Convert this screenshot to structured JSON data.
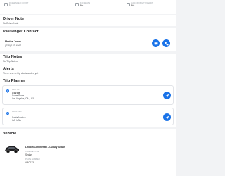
{
  "top_stats": [
    {
      "label": "PASSENGER COUNT",
      "value": "1"
    },
    {
      "label": "KID SEATS",
      "value": "No"
    },
    {
      "label": "ACCESSIBILITY NEEDS",
      "value": "No"
    }
  ],
  "driver_note": {
    "title": "Driver Note",
    "text": "No Driver Note"
  },
  "passenger_contact": {
    "title": "Passenger Contact",
    "name": "Martha Jones",
    "phone": "(718) 123-4567"
  },
  "trip_notes": {
    "title": "Trip Notes",
    "text": "No Trip Notes"
  },
  "alerts": {
    "title": "Alerts",
    "text": "There are no trip alerts added yet"
  },
  "trip_planner": {
    "title": "Trip Planner",
    "stops": [
      {
        "label": "PICK UP",
        "time": "4:00 pm",
        "line1": "Some Place",
        "line2": "Los Angeles, CA, USA"
      },
      {
        "label": "DROP OFF",
        "time": "—",
        "line1": "Santa Monica",
        "line2": "CA, USA"
      }
    ]
  },
  "vehicle": {
    "title": "Vehicle",
    "name": "Lincoln Continental – Luxury Sedan",
    "type_label": "VEHICLE TYPE",
    "type_value": "Sedan",
    "plate_label": "PLATE NUMBER",
    "plate_value": "ABC123"
  },
  "colors": {
    "accent": "#1a73e8",
    "background": "#f2f3f5",
    "card": "#ffffff"
  },
  "icons": [
    "person-icon",
    "child-seat-icon",
    "accessibility-icon",
    "message-icon",
    "phone-icon",
    "location-pin-icon",
    "navigate-icon",
    "car-image"
  ]
}
